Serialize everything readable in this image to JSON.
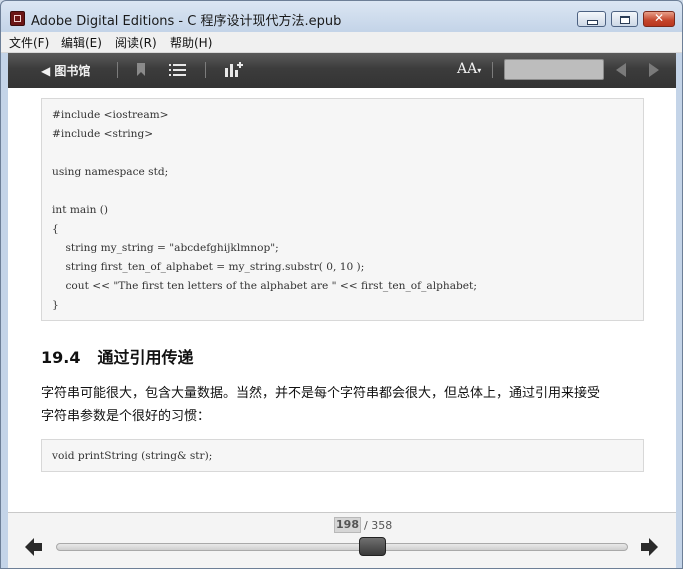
{
  "window": {
    "title": "Adobe Digital Editions - C  程序设计现代方法.epub"
  },
  "menu": {
    "file": "文件(F)",
    "edit": "编辑(E)",
    "read": "阅读(R)",
    "help": "帮助(H)"
  },
  "toolbar": {
    "library_label": "◀ 图书馆",
    "font_size_label": "AA"
  },
  "content": {
    "code_block_1": [
      "#include <iostream>",
      "#include <string>",
      "",
      "using namespace std;",
      "",
      "int main ()",
      "{",
      "    string my_string = \"abcdefghijklmnop\";",
      "    string first_ten_of_alphabet = my_string.substr( 0, 10 );",
      "    cout << \"The first ten letters of the alphabet are \" << first_ten_of_alphabet;",
      "}"
    ],
    "section_number": "19.4",
    "section_title": "通过引用传递",
    "paragraph_line_1": "字符串可能很大，包含大量数据。当然，并不是每个字符串都会很大，但总体上，通过引用来接受",
    "paragraph_line_2": "字符串参数是个很好的习惯：",
    "code_block_2": "void printString (string& str);"
  },
  "pagination": {
    "current_page": "198",
    "total_pages": "/ 358",
    "progress": 0.553
  },
  "colors": {
    "toolbar_bg": "#3c3c3c",
    "code_bg": "#f6f6f6",
    "close_button": "#c4452b"
  }
}
